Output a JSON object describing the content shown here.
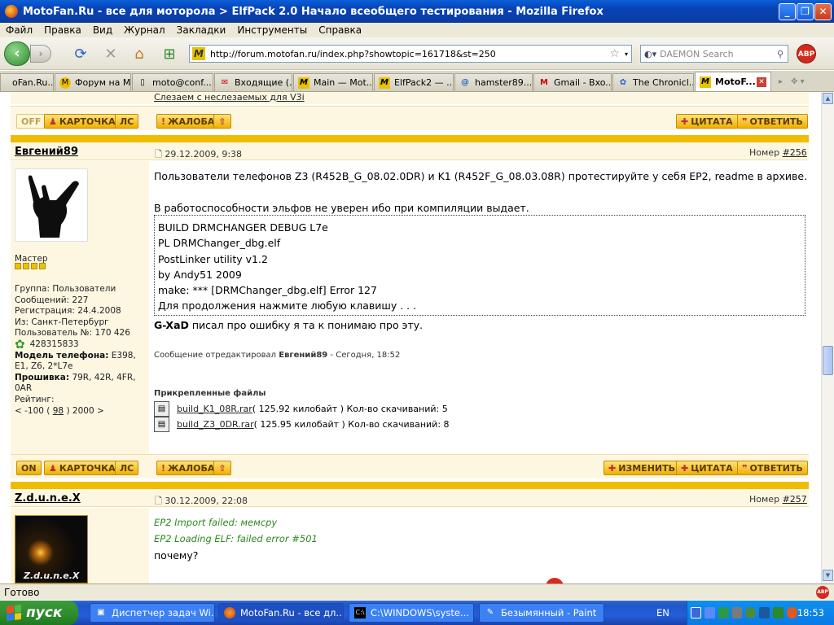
{
  "window": {
    "title": "MotoFan.Ru - все для моторола > ElfPack 2.0 Начало всеобщего тестирования - Mozilla Firefox",
    "min_btn": "_",
    "max_btn": "❐",
    "close_btn": "✕"
  },
  "menu": [
    "Файл",
    "Правка",
    "Вид",
    "Журнал",
    "Закладки",
    "Инструменты",
    "Справка"
  ],
  "nav": {
    "back": "‹",
    "forward": "›",
    "url": "http://forum.motofan.ru/index.php?showtopic=161718&st=250",
    "search_placeholder": "DAEMON Search",
    "abp": "ABP"
  },
  "tabs": [
    {
      "label": "oFan.Ru...",
      "icon": "M"
    },
    {
      "label": "Форум на M...",
      "icon": "M"
    },
    {
      "label": "moto@conf...",
      "icon": "📄"
    },
    {
      "label": "Входящие (...",
      "icon": "Я"
    },
    {
      "label": "Main — Mot...",
      "icon": "M"
    },
    {
      "label": "ElfPack2 — ...",
      "icon": "M"
    },
    {
      "label": "hamster89...",
      "icon": "@"
    },
    {
      "label": "Gmail - Bxo...",
      "icon": "M"
    },
    {
      "label": "The Chronicl...",
      "icon": "🦋"
    },
    {
      "label": "MotoF...",
      "icon": "M"
    }
  ],
  "content": {
    "top_snippet": "Слезаем с неслезаемых для V3i",
    "post1_buttons": {
      "status": "OFF",
      "card": "КАРТОЧКА",
      "pm": "ЛС",
      "complaint": "ЖАЛОБА",
      "quote": "ЦИТАТА",
      "reply": "ОТВЕТИТЬ"
    },
    "post2": {
      "author": "Евгений89",
      "date": "29.12.2009, 9:38",
      "number_label": "Номер",
      "number": "#256",
      "rank": "Мастер",
      "stars": "★★★★",
      "group": "Группа: Пользователи",
      "messages": "Сообщений: 227",
      "registered": "Регистрация: 24.4.2008",
      "from": "Из: Санкт-Петербург",
      "user_no": "Пользователь №: 170 426",
      "icq": "428315833",
      "phone_label": "Модель телефона:",
      "phone_value": "E398, E1, Z6, 2*L7e",
      "firmware_label": "Прошивка:",
      "firmware_value": "79R, 42R, 4FR, 0AR",
      "rating_label": "Рейтинг:",
      "rating_pre": "< -100 ( ",
      "rating_link": "98",
      "rating_post": " ) 2000 >",
      "text1": "Пользователи телефонов Z3 (R452B_G_08.02.0DR) и K1 (R452F_G_08.03.08R) протестируйте у себя EP2, readme в архиве.",
      "text2": "В работоспособности эльфов не уверен ибо при компиляции выдает.",
      "code_lines": [
        "BUILD DRMCHANGER DEBUG L7e",
        "PL DRMChanger_dbg.elf",
        "PostLinker utility v1.2",
        "by Andy51 2009",
        "make: *** [DRMChanger_dbg.elf] Error 127",
        "Для продолжения нажмите любую клавишу . . ."
      ],
      "text3_name": "G-XaD",
      "text3_rest": " писал про ошибку я та к понимаю про эту.",
      "edited_pre": "Сообщение отредактировал ",
      "edited_name": "Евгений89",
      "edited_post": " - Сегодня, 18:52",
      "attach_title": "Прикрепленные файлы",
      "attachments": [
        {
          "name": "build_K1_08R.rar",
          "info": " ( 125.92 килобайт ) Кол-во скачиваний: 5"
        },
        {
          "name": "build_Z3_0DR.rar",
          "info": " ( 125.95 килобайт ) Кол-во скачиваний: 8"
        }
      ]
    },
    "post2_buttons": {
      "status": "ON",
      "card": "КАРТОЧКА",
      "pm": "ЛС",
      "complaint": "ЖАЛОБА",
      "edit": "ИЗМЕНИТЬ",
      "quote": "ЦИТАТА",
      "reply": "ОТВЕТИТЬ"
    },
    "post3": {
      "author": "Z.d.u.n.e.X",
      "date": "30.12.2009, 22:08",
      "number_label": "Номер",
      "number": "#257",
      "line1": "EP2 Import failed: мемсру",
      "line2": "EP2 Loading ELF: failed error #501",
      "line3": "почему?",
      "avatar_text": "Z.d.u.n.e.X"
    }
  },
  "status": {
    "text": "Готово"
  },
  "taskbar": {
    "start": "пуск",
    "tasks": [
      {
        "label": "Диспетчер задач Wi...",
        "icon": "🖥"
      },
      {
        "label": "MotoFan.Ru - все дл...",
        "icon": "🦊"
      },
      {
        "label": "C:\\WINDOWS\\syste...",
        "icon": "C"
      },
      {
        "label": "Безымянный - Paint",
        "icon": "🖌"
      }
    ],
    "lang": "EN",
    "clock": "18:53"
  },
  "colors": {
    "forum_gold": "#f0bc00",
    "panel_bg": "#fdf7e2",
    "xp_blue": "#245edb",
    "xp_green": "#2d8a2d"
  }
}
